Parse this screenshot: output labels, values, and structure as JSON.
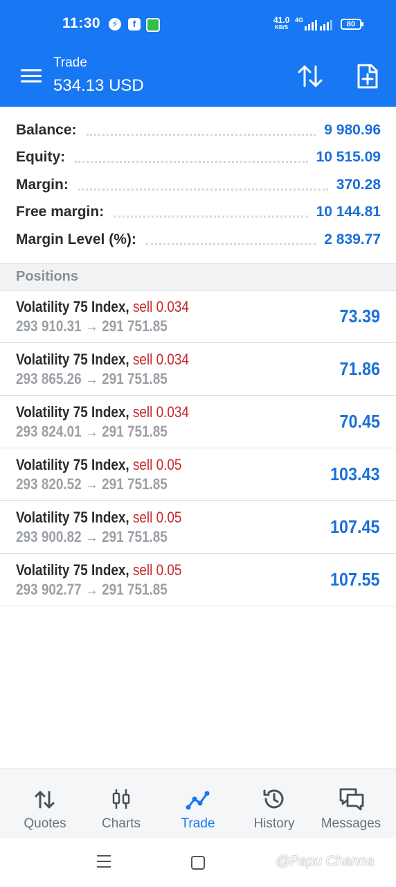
{
  "status_bar": {
    "time": "11:30",
    "apps": [
      "messenger-icon",
      "facebook-icon",
      "green-app-icon"
    ],
    "speed_value": "41.0",
    "speed_unit": "KB/S",
    "network": "4G",
    "battery": "80"
  },
  "appbar": {
    "title": "Trade",
    "subtitle": "534.13 USD",
    "icons": [
      "menu-icon",
      "sort-icon",
      "new-order-icon"
    ]
  },
  "summary": {
    "rows": [
      {
        "label": "Balance:",
        "value": "9 980.96"
      },
      {
        "label": "Equity:",
        "value": "10 515.09"
      },
      {
        "label": "Margin:",
        "value": "370.28"
      },
      {
        "label": "Free margin:",
        "value": "10 144.81"
      },
      {
        "label": "Margin Level (%):",
        "value": "2 839.77"
      }
    ]
  },
  "positions": {
    "header": "Positions",
    "items": [
      {
        "symbol": "Volatility 75 Index,",
        "side": "sell 0.034",
        "prices": "293 910.31 → 291 751.85",
        "profit": "73.39"
      },
      {
        "symbol": "Volatility 75 Index,",
        "side": "sell 0.034",
        "prices": "293 865.26 → 291 751.85",
        "profit": "71.86"
      },
      {
        "symbol": "Volatility 75 Index,",
        "side": "sell 0.034",
        "prices": "293 824.01 → 291 751.85",
        "profit": "70.45"
      },
      {
        "symbol": "Volatility 75 Index,",
        "side": "sell 0.05",
        "prices": "293 820.52 → 291 751.85",
        "profit": "103.43"
      },
      {
        "symbol": "Volatility 75 Index,",
        "side": "sell 0.05",
        "prices": "293 900.82 → 291 751.85",
        "profit": "107.45"
      },
      {
        "symbol": "Volatility 75 Index,",
        "side": "sell 0.05",
        "prices": "293 902.77 → 291 751.85",
        "profit": "107.55"
      }
    ]
  },
  "bottom_nav": {
    "items": [
      {
        "label": "Quotes",
        "icon": "quotes-icon"
      },
      {
        "label": "Charts",
        "icon": "charts-icon"
      },
      {
        "label": "Trade",
        "icon": "trade-icon",
        "active": true
      },
      {
        "label": "History",
        "icon": "history-icon"
      },
      {
        "label": "Messages",
        "icon": "messages-icon"
      }
    ]
  },
  "watermark": "@Papu Channa",
  "colors": {
    "accent": "#1877f2",
    "value_blue": "#1a6fd8",
    "sell_red": "#c62828"
  }
}
